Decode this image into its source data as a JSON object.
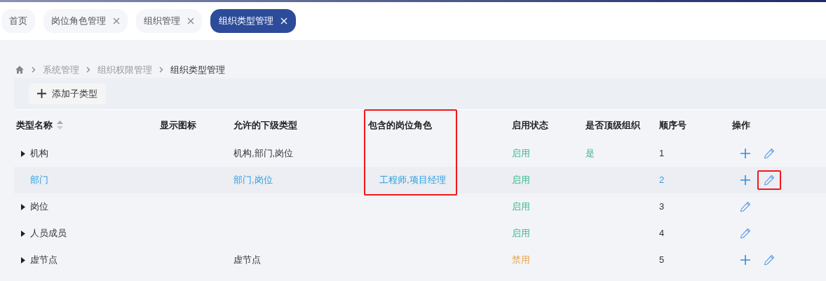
{
  "tabs": [
    {
      "label": "首页",
      "closable": false,
      "selected": false
    },
    {
      "label": "岗位角色管理",
      "closable": true,
      "selected": false
    },
    {
      "label": "组织管理",
      "closable": true,
      "selected": false
    },
    {
      "label": "组织类型管理",
      "closable": true,
      "selected": true
    }
  ],
  "breadcrumb": [
    "系统管理",
    "组织权限管理",
    "组织类型管理"
  ],
  "toolbar": {
    "add_button": "添加子类型"
  },
  "table": {
    "columns": [
      {
        "label": "类型名称",
        "sortable": true,
        "outlined": false
      },
      {
        "label": "显示图标",
        "sortable": false,
        "outlined": false
      },
      {
        "label": "允许的下级类型",
        "sortable": false,
        "outlined": false
      },
      {
        "label": "包含的岗位角色",
        "sortable": false,
        "outlined": true
      },
      {
        "label": "启用状态",
        "sortable": false,
        "outlined": false
      },
      {
        "label": "是否顶级组织",
        "sortable": false,
        "outlined": false
      },
      {
        "label": "顺序号",
        "sortable": false,
        "outlined": false
      },
      {
        "label": "操作",
        "sortable": false,
        "outlined": false
      }
    ],
    "rows": [
      {
        "name": "机构",
        "expandable": true,
        "selected": false,
        "allowed": "机构,部门,岗位",
        "roles": "",
        "status": "启用",
        "enabled": true,
        "top_level": "是",
        "order": "1",
        "actions": [
          {
            "kind": "add",
            "outlined": false
          },
          {
            "kind": "edit",
            "outlined": false
          }
        ]
      },
      {
        "name": "部门",
        "expandable": false,
        "selected": true,
        "allowed": "部门,岗位",
        "roles": "工程师,项目经理",
        "status": "启用",
        "enabled": true,
        "top_level": "",
        "order": "2",
        "actions": [
          {
            "kind": "add",
            "outlined": false
          },
          {
            "kind": "edit",
            "outlined": true
          }
        ]
      },
      {
        "name": "岗位",
        "expandable": true,
        "selected": false,
        "allowed": "",
        "roles": "",
        "status": "启用",
        "enabled": true,
        "top_level": "",
        "order": "3",
        "actions": [
          {
            "kind": "edit",
            "outlined": false
          }
        ]
      },
      {
        "name": "人员成员",
        "expandable": true,
        "selected": false,
        "allowed": "",
        "roles": "",
        "status": "启用",
        "enabled": true,
        "top_level": "",
        "order": "4",
        "actions": [
          {
            "kind": "edit",
            "outlined": false
          }
        ]
      },
      {
        "name": "虚节点",
        "expandable": true,
        "selected": false,
        "allowed": "虚节点",
        "roles": "",
        "status": "禁用",
        "enabled": false,
        "top_level": "",
        "order": "5",
        "actions": [
          {
            "kind": "add",
            "outlined": false
          },
          {
            "kind": "edit",
            "outlined": false
          }
        ]
      }
    ]
  }
}
